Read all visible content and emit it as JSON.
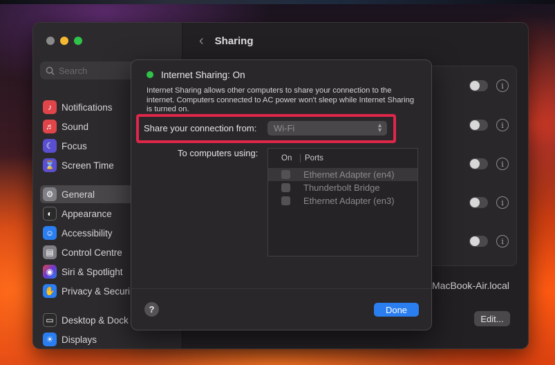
{
  "window": {
    "title": "Sharing",
    "search_placeholder": "Search"
  },
  "sidebar": {
    "items": [
      {
        "label": "Notifications",
        "icon": "bell-icon",
        "color": "#e0454a",
        "selected": false
      },
      {
        "label": "Sound",
        "icon": "speaker-icon",
        "color": "#e0454a",
        "selected": false
      },
      {
        "label": "Focus",
        "icon": "moon-icon",
        "color": "#5a4fd0",
        "selected": false
      },
      {
        "label": "Screen Time",
        "icon": "hourglass-icon",
        "color": "#5a4fd0",
        "selected": false
      },
      {
        "label": "General",
        "icon": "gear-icon",
        "color": "#7f7f85",
        "selected": true
      },
      {
        "label": "Appearance",
        "icon": "appearance-icon",
        "color": "#2a2a2a",
        "selected": false
      },
      {
        "label": "Accessibility",
        "icon": "accessibility-icon",
        "color": "#2a7ef0",
        "selected": false
      },
      {
        "label": "Control Centre",
        "icon": "control-centre-icon",
        "color": "#7f7f85",
        "selected": false
      },
      {
        "label": "Siri & Spotlight",
        "icon": "siri-icon",
        "color": "#6a3ad0",
        "selected": false
      },
      {
        "label": "Privacy & Securi",
        "icon": "hand-icon",
        "color": "#2a7ef0",
        "selected": false
      },
      {
        "label": "Desktop & Dock",
        "icon": "dock-icon",
        "color": "#2a2a2a",
        "selected": false
      },
      {
        "label": "Displays",
        "icon": "sun-icon",
        "color": "#2a7ef0",
        "selected": false
      }
    ]
  },
  "content": {
    "hostname": "MacBook-Air.local",
    "edit_label": "Edit..."
  },
  "dialog": {
    "status_title": "Internet Sharing: On",
    "status_color": "#2fc34a",
    "description": "Internet Sharing allows other computers to share your connection to the internet. Computers connected to AC power won't sleep while Internet Sharing is turned on.",
    "share_label": "Share your connection from:",
    "share_value": "Wi-Fi",
    "to_label": "To computers using:",
    "table": {
      "col_on": "On",
      "col_ports": "Ports",
      "rows": [
        {
          "port": "Ethernet Adapter (en4)",
          "checked": false,
          "selected": true
        },
        {
          "port": "Thunderbolt Bridge",
          "checked": false,
          "selected": false
        },
        {
          "port": "Ethernet Adapter (en3)",
          "checked": false,
          "selected": false
        }
      ]
    },
    "help_label": "?",
    "done_label": "Done",
    "highlight_color": "#e0264a"
  }
}
